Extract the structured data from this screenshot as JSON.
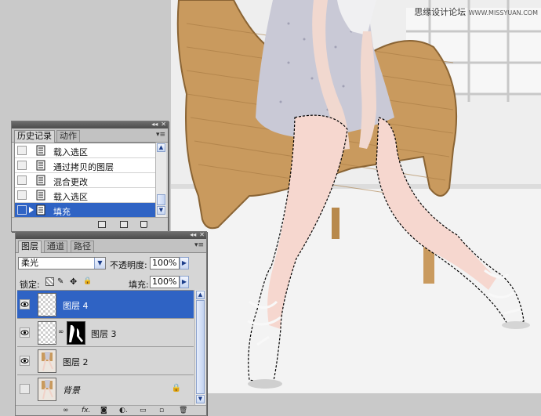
{
  "watermark": {
    "text": "思缘设计论坛",
    "url": "WWW.MISSYUAN.COM"
  },
  "history_panel": {
    "tabs": [
      "历史记录",
      "动作"
    ],
    "items": [
      {
        "label": "载入选区",
        "selected": false
      },
      {
        "label": "通过拷贝的图层",
        "selected": false
      },
      {
        "label": "混合更改",
        "selected": false
      },
      {
        "label": "载入选区",
        "selected": false
      },
      {
        "label": "填充",
        "selected": true
      }
    ]
  },
  "layers_panel": {
    "tabs": [
      "图层",
      "通道",
      "路径"
    ],
    "blend_mode": "柔光",
    "opacity_label": "不透明度:",
    "opacity_value": "100%",
    "lock_label": "锁定:",
    "fill_label": "填充:",
    "fill_value": "100%",
    "layers": [
      {
        "name": "图层 4",
        "selected": true,
        "visible": true,
        "has_mask": false,
        "thumb": "transparent"
      },
      {
        "name": "图层 3",
        "selected": false,
        "visible": true,
        "has_mask": true,
        "thumb": "transparent"
      },
      {
        "name": "图层 2",
        "selected": false,
        "visible": true,
        "has_mask": false,
        "thumb": "photo"
      },
      {
        "name": "背景",
        "selected": false,
        "visible": false,
        "has_mask": false,
        "thumb": "photo",
        "locked": true
      }
    ]
  },
  "colors": {
    "selection": "#2f63c4",
    "panel_bg": "#d6d6d6",
    "canvas_bg": "#c9c9c9"
  }
}
